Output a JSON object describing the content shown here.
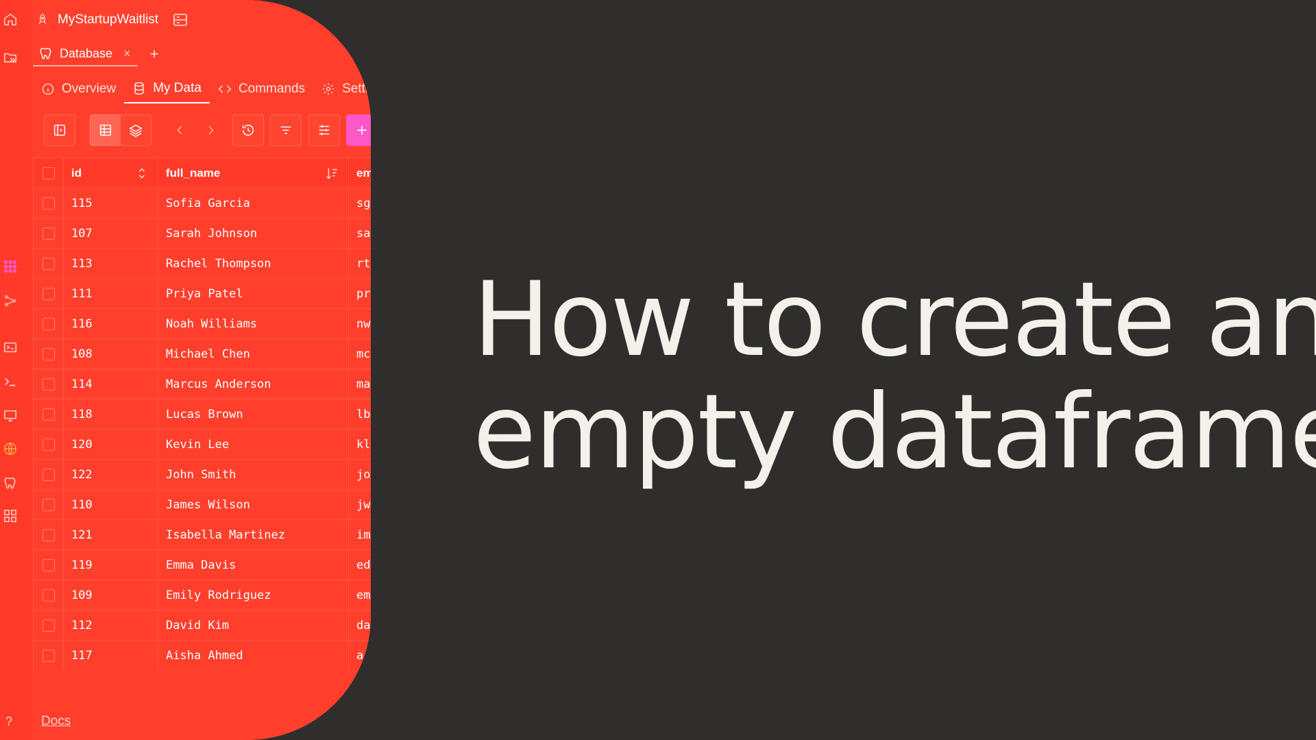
{
  "sidebar_rail": {
    "icons": [
      "home-icon",
      "folder-open-icon",
      "apps-grid-icon",
      "share-nodes-icon",
      "send-list-icon",
      "terminal-icon",
      "monitor-icon",
      "globe-icon",
      "postgres-elephant-icon",
      "dashboard-grid-icon"
    ],
    "help_label": "?"
  },
  "project": {
    "title": "MyStartupWaitlist"
  },
  "file_tab": {
    "label": "Database",
    "close": "×",
    "add": "+"
  },
  "nav_tabs": [
    {
      "label": "Overview",
      "icon": "info-icon",
      "active": false
    },
    {
      "label": "My Data",
      "icon": "database-icon",
      "active": true
    },
    {
      "label": "Commands",
      "icon": "code-icon",
      "active": false
    },
    {
      "label": "Settings",
      "icon": "gear-icon",
      "active": false
    }
  ],
  "table": {
    "columns": [
      "id",
      "full_name",
      "email"
    ],
    "rows": [
      {
        "id": "115",
        "full_name": "Sofia Garcia",
        "email": "sg"
      },
      {
        "id": "107",
        "full_name": "Sarah Johnson",
        "email": "sa"
      },
      {
        "id": "113",
        "full_name": "Rachel Thompson",
        "email": "rt"
      },
      {
        "id": "111",
        "full_name": "Priya Patel",
        "email": "pr"
      },
      {
        "id": "116",
        "full_name": "Noah Williams",
        "email": "nw"
      },
      {
        "id": "108",
        "full_name": "Michael Chen",
        "email": "mc"
      },
      {
        "id": "114",
        "full_name": "Marcus Anderson",
        "email": "ma"
      },
      {
        "id": "118",
        "full_name": "Lucas Brown",
        "email": "lb"
      },
      {
        "id": "120",
        "full_name": "Kevin Lee",
        "email": "kl"
      },
      {
        "id": "122",
        "full_name": "John Smith",
        "email": "jo"
      },
      {
        "id": "110",
        "full_name": "James Wilson",
        "email": "jw"
      },
      {
        "id": "121",
        "full_name": "Isabella Martinez",
        "email": "im"
      },
      {
        "id": "119",
        "full_name": "Emma Davis",
        "email": "ed"
      },
      {
        "id": "109",
        "full_name": "Emily Rodriguez",
        "email": "em"
      },
      {
        "id": "112",
        "full_name": "David Kim",
        "email": "da"
      },
      {
        "id": "117",
        "full_name": "Aisha Ahmed",
        "email": "a."
      }
    ]
  },
  "footer": {
    "docs_label": "Docs"
  },
  "headline": {
    "line1": "How to create an",
    "line2": "empty dataframe"
  },
  "colors": {
    "panel": "#ff3d2b",
    "background": "#302d2d",
    "headline_text": "#f4f1ea",
    "accent_plus": "#ff57c8"
  }
}
